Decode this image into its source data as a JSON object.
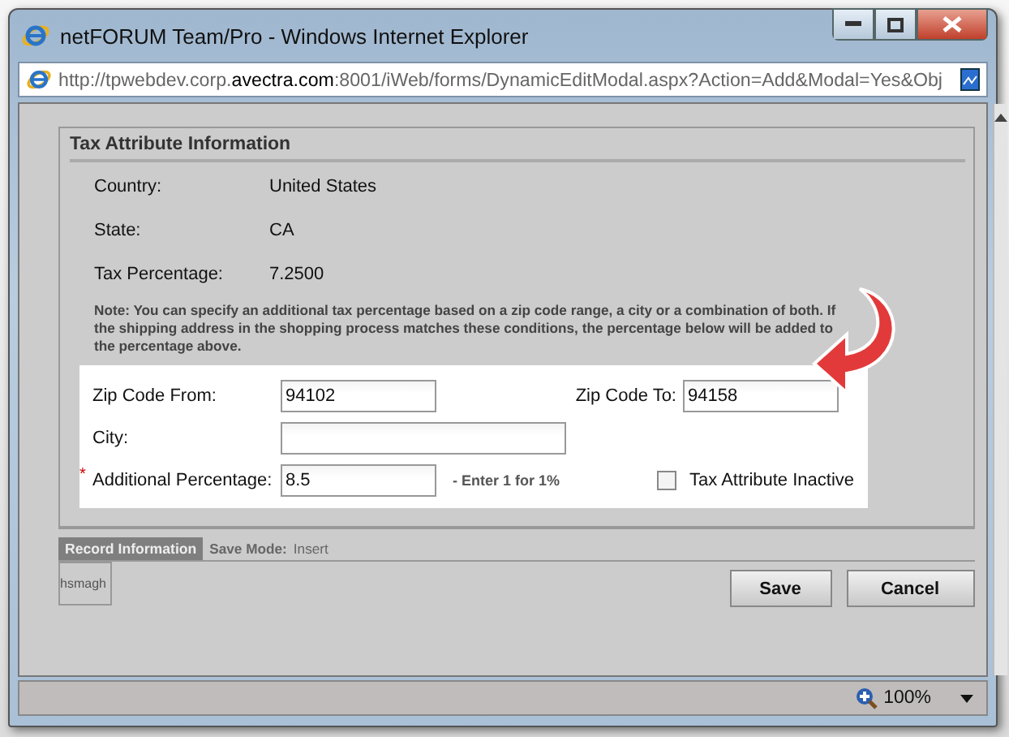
{
  "window": {
    "title": "netFORUM Team/Pro - Windows Internet Explorer"
  },
  "address_bar": {
    "url_parts": [
      {
        "text": "http://tpwebdev.corp.",
        "strong": false
      },
      {
        "text": "avectra.com",
        "strong": true
      },
      {
        "text": ":8001/iWeb/forms/DynamicEditModal.aspx?Action=Add&Modal=Yes&Obj",
        "strong": false
      }
    ]
  },
  "section": {
    "title": "Tax Attribute Information",
    "info_rows": [
      {
        "label": "Country:",
        "value": "United States"
      },
      {
        "label": "State:",
        "value": "CA"
      },
      {
        "label": "Tax Percentage:",
        "value": "7.2500"
      }
    ],
    "note": "Note: You can specify an additional tax percentage based on a zip code range, a city or a combination of both. If the shipping address in the shopping process matches these conditions, the percentage below will be added to the percentage above.",
    "form": {
      "zip_from": {
        "label": "Zip Code From:",
        "value": "94102"
      },
      "zip_to": {
        "label": "Zip Code To:",
        "value": "94158"
      },
      "city": {
        "label": "City:"
      },
      "additional_percentage": {
        "label": "Additional Percentage:",
        "value": "8.5",
        "required_mark": "*",
        "hint": "- Enter 1 for 1%"
      },
      "inactive": {
        "label": "Tax Attribute Inactive",
        "checked": false
      }
    }
  },
  "record_info": {
    "tab": "Record Information",
    "save_mode_label": "Save Mode:",
    "save_mode": "Insert",
    "user": "hsmagh"
  },
  "buttons": [
    "Save",
    "Cancel"
  ],
  "status_bar": {
    "zoom": "100%"
  }
}
